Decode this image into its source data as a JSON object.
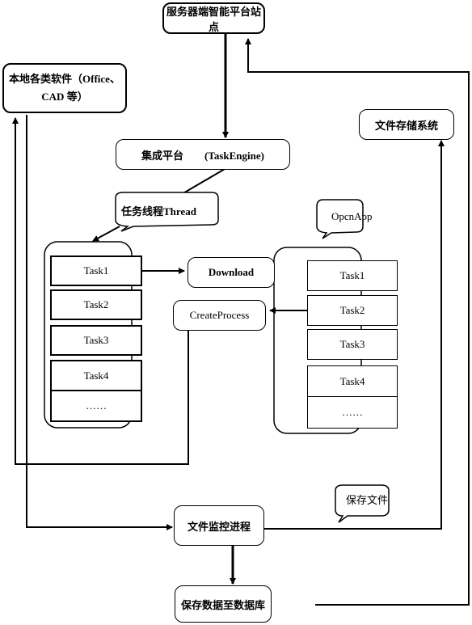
{
  "diagram": {
    "server_site": "服务器端智能平台站点",
    "local_software_line1": "本地各类软件（Office、",
    "local_software_line2": "CAD 等）",
    "file_storage": "文件存储系统",
    "integration_platform": "集成平台　　(TaskEngine)",
    "thread_bubble": "任务线程Thread",
    "openapp_bubble": "OpcnApp",
    "left_tasks": [
      "Task1",
      "Task2",
      "Task3",
      "Task4",
      "……"
    ],
    "right_tasks": [
      "Task1",
      "Task2",
      "Task3",
      "Task4",
      "……"
    ],
    "download": "Download",
    "create_process": "CreateProcess",
    "save_file_bubble": "保存文件",
    "file_monitor": "文件监控进程",
    "save_db": "保存数据至数据库"
  }
}
